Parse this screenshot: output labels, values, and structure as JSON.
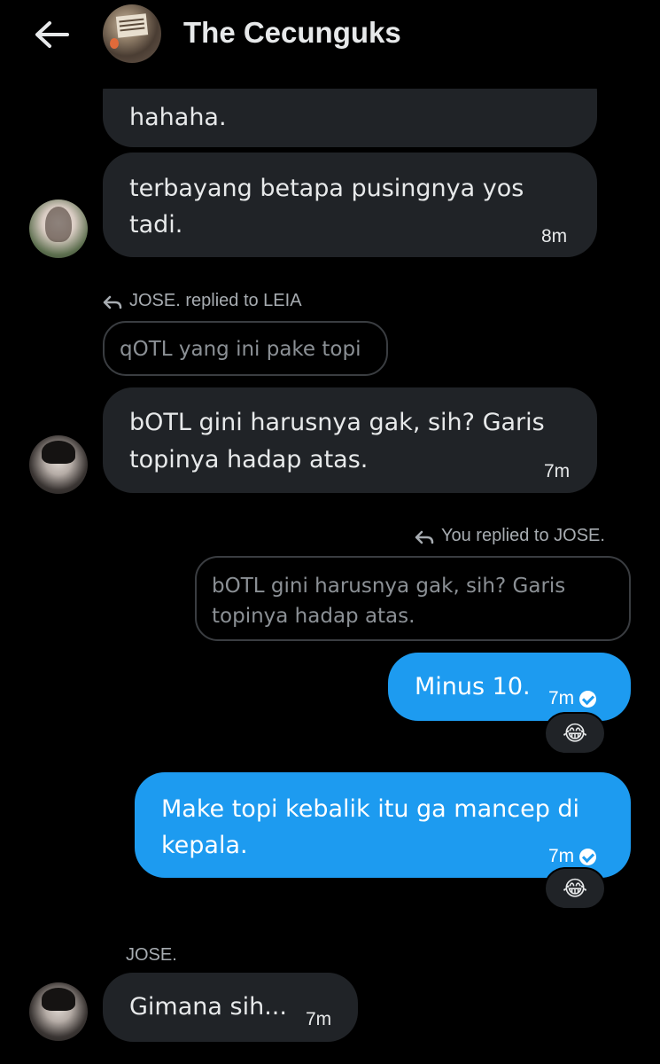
{
  "header": {
    "title": "The Cecunguks"
  },
  "messages": {
    "m1": {
      "text": "hahaha."
    },
    "m2": {
      "text": "terbayang betapa pusingnya yos tadi.",
      "line1": "terbayang betapa pusingnya yos",
      "line2": "tadi.",
      "time": "8m"
    },
    "reply1": {
      "label": "JOSE. replied to LEIA",
      "quote": "qOTL yang ini pake topi"
    },
    "m3": {
      "line1": "bOTL gini harusnya gak, sih? Garis",
      "line2": "topinya hadap atas.",
      "time": "7m"
    },
    "reply2": {
      "label": "You replied to JOSE.",
      "quote_line1": "bOTL gini harusnya gak, sih? Garis",
      "quote_line2": "topinya hadap atas."
    },
    "m4": {
      "text": "Minus 10.",
      "time": "7m",
      "reaction": "😂"
    },
    "m5": {
      "line1": "Make topi kebalik itu ga mancep di",
      "line2": "kepala.",
      "time": "7m",
      "reaction": "😂"
    },
    "m6": {
      "sender": "JOSE.",
      "text": "Gimana sih...",
      "time": "7m"
    }
  }
}
